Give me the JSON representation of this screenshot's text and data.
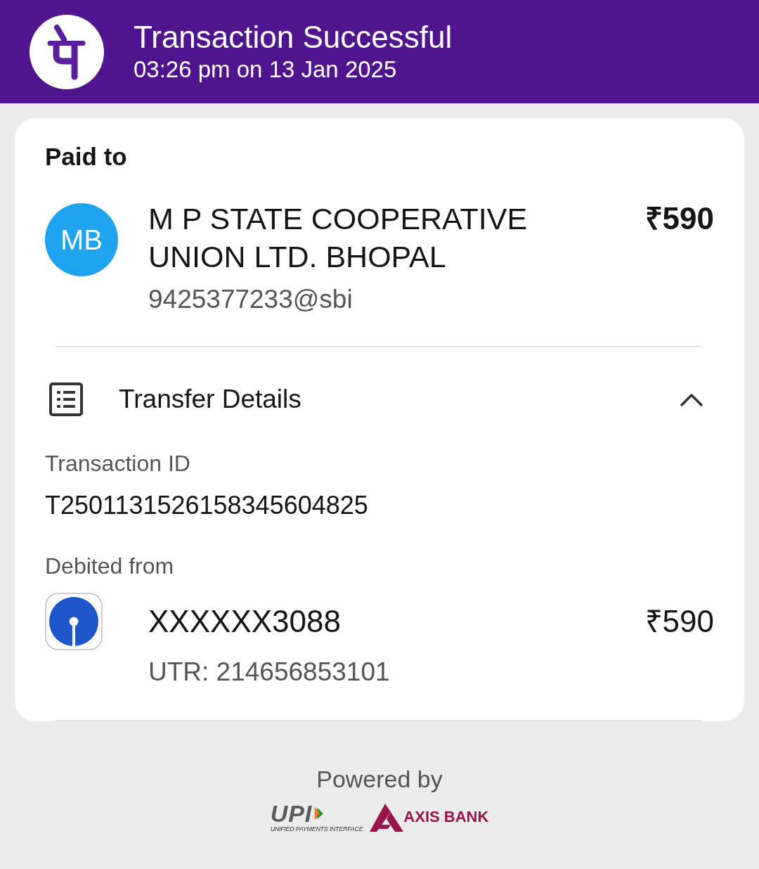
{
  "header": {
    "title": "Transaction Successful",
    "datetime": "03:26 pm on 13 Jan 2025"
  },
  "paid_to": {
    "label": "Paid to",
    "avatar_initials": "MB",
    "name": "M P STATE COOPERATIVE UNION LTD. BHOPAL",
    "upi_id": "9425377233@sbi",
    "amount": "₹590"
  },
  "transfer_details": {
    "title": "Transfer Details",
    "expanded": true,
    "transaction_id_label": "Transaction ID",
    "transaction_id": "T2501131526158345604825",
    "debited_from_label": "Debited from",
    "account": "XXXXXX3088",
    "amount": "₹590",
    "utr": "UTR: 214656853101"
  },
  "footer": {
    "powered_by": "Powered by",
    "upi_logo_text": "UPI",
    "upi_tagline": "UNIFIED PAYMENTS INTERFACE",
    "bank_name": "AXIS BANK"
  }
}
